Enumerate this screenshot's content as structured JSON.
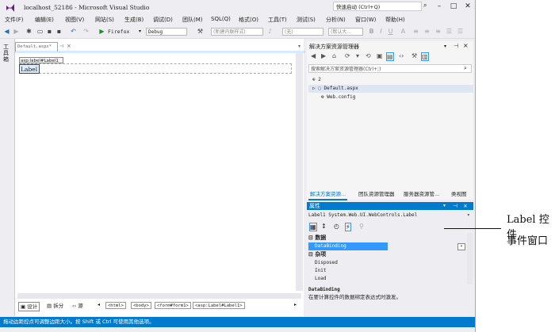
{
  "title_bar": {
    "title": "localhost_52186 - Microsoft Visual Studio",
    "quick_launch": "快速启动 (Ctrl+Q)"
  },
  "menu": [
    "文件(F)",
    "编辑(E)",
    "视图(V)",
    "网站(S)",
    "生成(B)",
    "调试(D)",
    "团队(M)",
    "SQL(Q)",
    "格式(O)",
    "工具(T)",
    "测试(S)",
    "分析(N)",
    "窗口(W)",
    "帮助(H)"
  ],
  "toolbar": {
    "browser": "Firefox",
    "config": "Debug",
    "style_box": "(新建内联样式)",
    "block_format": "(无)",
    "font_size": "(默认大...",
    "bold": "B",
    "italic": "I",
    "underline": "U"
  },
  "editor": {
    "toolbox_label": "工具箱",
    "tab_label": "Default.aspx*",
    "tag_tip": "asp:label#Label1",
    "label_control": "Label"
  },
  "bottom_bar": {
    "design": "设计",
    "split": "拆分",
    "source": "源",
    "crumbs": [
      "<html>",
      "<body>",
      "<form#form1>",
      "<asp:Label#Label1>"
    ]
  },
  "status": "拖动边距控点可调整边距大小。按 Shift 或 Ctrl 可使用其他选项。",
  "solution_explorer": {
    "title": "解决方案资源管理器",
    "search_placeholder": "搜索解决方案资源管理器(Ctrl+;)",
    "items": [
      "2",
      "Default.aspx",
      "Web.config"
    ],
    "tabs": [
      "解决方案资源...",
      "团队资源管理器",
      "服务器资源管...",
      "类视图"
    ]
  },
  "properties": {
    "title": "属性",
    "selected": "Label1 System.Web.UI.WebControls.Label",
    "sections": [
      {
        "name": "数据",
        "rows": [
          "DataBinding"
        ]
      },
      {
        "name": "杂项",
        "rows": [
          "Disposed",
          "Init",
          "Load"
        ]
      }
    ],
    "desc_title": "DataBinding",
    "desc_text": "在要计算控件的数据绑定表达式时激发。"
  },
  "annotation": {
    "line1": "Label 控件",
    "line2": "事件窗口"
  },
  "colors": {
    "accent": "#007acc",
    "selection": "#3399ff",
    "chrome": "#eeeef2"
  }
}
